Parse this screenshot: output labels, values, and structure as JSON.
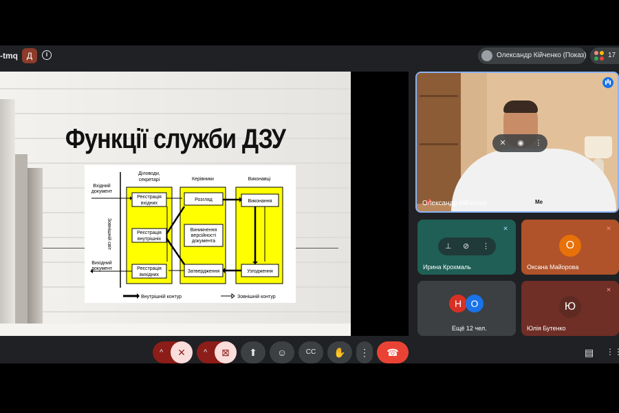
{
  "topbar": {
    "meet_code": "-tmq",
    "host_badge": "Д",
    "presenter_label": "Олександр Кійченко (Показ)",
    "participant_count": "17"
  },
  "slide": {
    "title": "Функції служби ДЗУ",
    "diagram": {
      "col_headers": [
        "Діловоди, секретарі",
        "Керівники",
        "Виконавці"
      ],
      "side_label": "Зовнішній світ",
      "input_doc": [
        "Вхідний",
        "документ"
      ],
      "output_doc": [
        "Вихідний",
        "документ"
      ],
      "boxes": {
        "reg_in": [
          "Реєстрація",
          "вхідних"
        ],
        "reg_internal": [
          "Реєстрація",
          "внутрішніх"
        ],
        "reg_out": [
          "Реєстрація",
          "вихідних"
        ],
        "review": "Розгляд",
        "versions": [
          "Виникнення",
          "версійності",
          "документа"
        ],
        "approval": "Затвердження",
        "execution": "Виконання",
        "agreement": "Узгодження"
      },
      "legend_internal": "Внутрішній контур",
      "legend_external": "Зовнішній контур"
    }
  },
  "participants": {
    "main": {
      "name": "Олександр Кійченко",
      "shirt_logo": "Me"
    },
    "tiles": [
      {
        "name": "Ирина Крохмаль",
        "color": "#1f5f55"
      },
      {
        "name": "Оксана Майорова",
        "initial": "О",
        "color": "#b0532a",
        "avatar_color": "#e8710a"
      },
      {
        "name": "Ещё 12 чел.",
        "initials": [
          "Н",
          "О"
        ],
        "color": "#3c4043"
      },
      {
        "name": "Юлія Бутенко",
        "initial": "Ю",
        "color": "#6f2e26"
      }
    ]
  },
  "icons": {
    "more": "⋮",
    "chevron_up": "^",
    "mic_off": "🎙",
    "cam_off": "▭",
    "present": "⬆",
    "emoji": "☺",
    "captions": "CC",
    "hand": "✋",
    "end_call": "☎",
    "chat": "▤",
    "apps": "⋮⋮"
  }
}
